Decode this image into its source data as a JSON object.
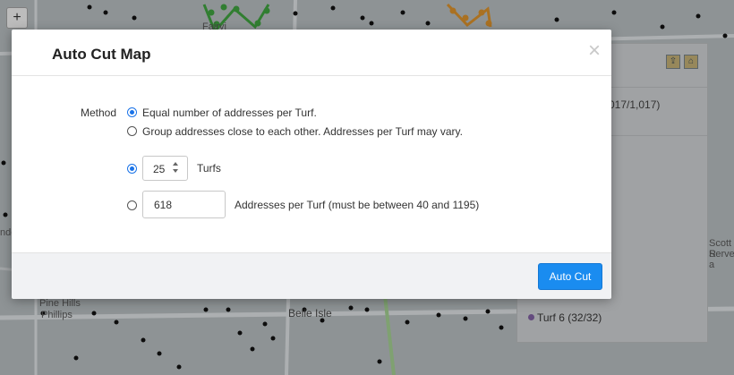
{
  "map": {
    "zoom_in_label": "+",
    "labels": {
      "top": "Fairvi",
      "left_mid": "ndo",
      "bottom_left_1": "Pine Hills",
      "bottom_left_2": "Phillips",
      "bottom_center": "Belle Isle",
      "right_1": "Scott R",
      "right_2": "Serve a"
    },
    "colors": {
      "background": "#aeb4b6",
      "road": "#d2d6d8",
      "green_route": "#3c9a3c",
      "orange_route": "#d08a2a",
      "address_dot": "#111111"
    }
  },
  "side_panel": {
    "count_text": "017/1,017)",
    "turf_item": "Turf 6  (32/32)",
    "icons": [
      "map-export-icon",
      "house-icon"
    ]
  },
  "modal": {
    "title": "Auto Cut Map",
    "close_label": "×",
    "method_label": "Method",
    "options": {
      "equal": "Equal number of addresses per Turf.",
      "group": "Group addresses close to each other. Addresses per Turf may vary."
    },
    "turfs_value": "25",
    "turfs_label": "Turfs",
    "addresses_value": "618",
    "addresses_label": "Addresses per Turf (must be between 40 and 1195)",
    "submit_label": "Auto Cut",
    "accent": "#1a8cf0"
  }
}
